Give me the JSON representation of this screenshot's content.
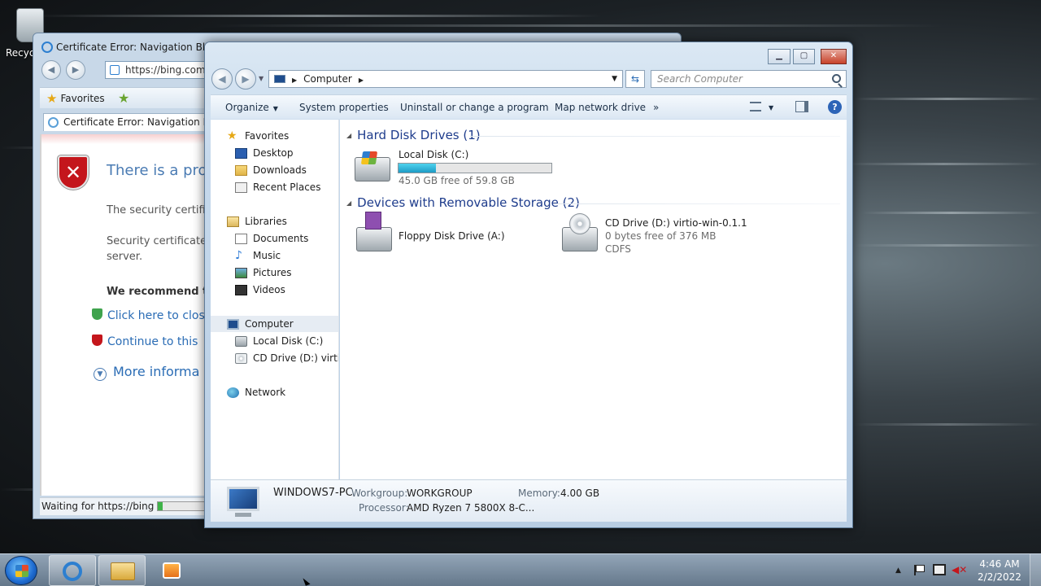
{
  "desktop": {
    "recycle_bin_label": "Recyc"
  },
  "ie_window": {
    "title": "Certificate Error: Navigation Blocke",
    "address": "https://bing.com/",
    "favorites_label": "Favorites",
    "tab_title": "Certificate Error: Navigation Block",
    "page": {
      "heading": "There is a probl",
      "para1": "The security certifica",
      "para2_line1": "Security certificate p",
      "para2_line2": "server.",
      "recommend": "We recommend th",
      "link_close": "Click here to clos",
      "link_continue": "Continue to this",
      "link_more": "More informa"
    },
    "status_text": "Waiting for https://bing"
  },
  "explorer": {
    "breadcrumb": "Computer",
    "search_placeholder": "Search Computer",
    "commands": {
      "organize": "Organize",
      "system_properties": "System properties",
      "uninstall": "Uninstall or change a program",
      "map_drive": "Map network drive",
      "overflow": "»"
    },
    "nav": {
      "favorites": "Favorites",
      "desktop": "Desktop",
      "downloads": "Downloads",
      "recent_places": "Recent Places",
      "libraries": "Libraries",
      "documents": "Documents",
      "music": "Music",
      "pictures": "Pictures",
      "videos": "Videos",
      "computer": "Computer",
      "local_disk": "Local Disk (C:)",
      "cd_drive": "CD Drive (D:) virtio-w",
      "network": "Network"
    },
    "groups": {
      "hdd_header": "Hard Disk Drives (1)",
      "removable_header": "Devices with Removable Storage (2)"
    },
    "drives": {
      "c_name": "Local Disk (C:)",
      "c_free": "45.0 GB free of 59.8 GB",
      "c_used_fraction": 0.247,
      "floppy_name": "Floppy Disk Drive (A:)",
      "cd_name": "CD Drive (D:) virtio-win-0.1.1",
      "cd_free": "0 bytes free of 376 MB",
      "cd_fs": "CDFS"
    },
    "details": {
      "pc_name": "WINDOWS7-PC",
      "workgroup_label": "Workgroup:",
      "workgroup_value": "WORKGROUP",
      "memory_label": "Memory:",
      "memory_value": "4.00 GB",
      "processor_label": "Processor:",
      "processor_value": "AMD Ryzen 7 5800X 8-C..."
    }
  },
  "taskbar": {
    "time": "4:46 AM",
    "date": "2/2/2022",
    "tray_up_arrow": "▲"
  }
}
